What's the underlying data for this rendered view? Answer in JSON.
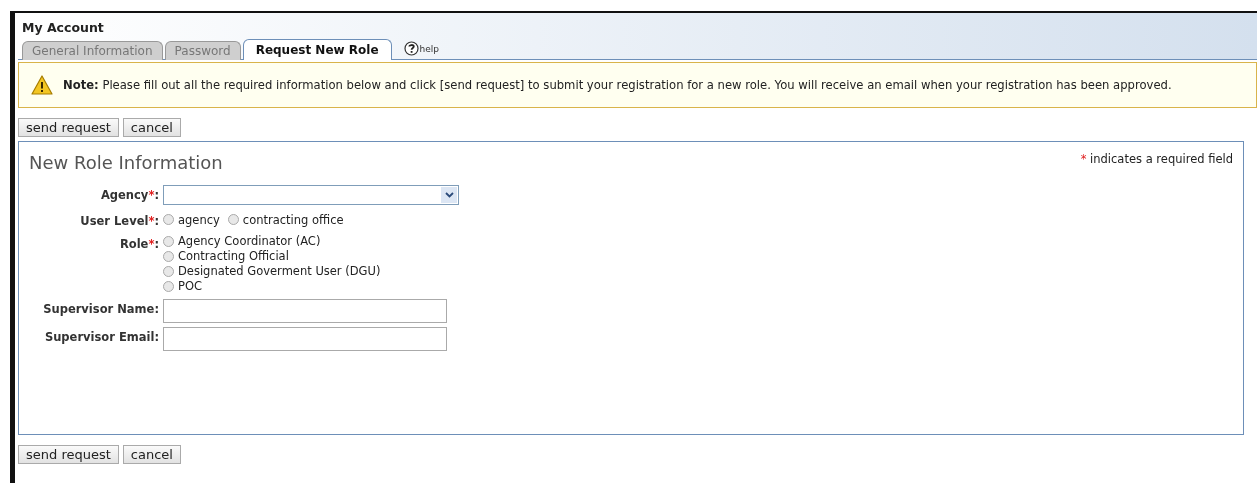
{
  "window": {
    "title": "My Account"
  },
  "tabs": [
    {
      "label": "General Information",
      "selected": false
    },
    {
      "label": "Password",
      "selected": false
    },
    {
      "label": "Request New Role",
      "selected": true
    }
  ],
  "help": {
    "label": "help"
  },
  "note": {
    "text": "**Note:** Please fill out all the required information below and click [send request] to submit your registration for a new role. You will receive an email when your registration has been approved."
  },
  "top_buttons": [
    "send request",
    "cancel"
  ],
  "panel": {
    "title": "New Role Information",
    "legend": {
      "mark": "*",
      "text": "indicates a required field"
    },
    "fields": [
      {
        "kind": "select",
        "label": "Agency",
        "required_mark": "*",
        "suffix": ":"
      },
      {
        "kind": "radio-inline",
        "label": "User Level",
        "required_mark": "*",
        "suffix": ":",
        "options": [
          {
            "label": "agency",
            "selected": false
          },
          {
            "label": "contracting office",
            "selected": false
          }
        ]
      },
      {
        "kind": "radio-list",
        "label": "Role",
        "required_mark": "*",
        "suffix": ":",
        "options": [
          {
            "label": "Agency Coordinator (AC)",
            "selected": false
          },
          {
            "label": "Contracting Official",
            "selected": false
          },
          {
            "label": "Designated Goverment User (DGU)",
            "selected": false
          },
          {
            "label": "POC",
            "selected": false
          }
        ]
      },
      {
        "kind": "text",
        "label": "Supervisor Name",
        "suffix": ":"
      },
      {
        "kind": "text",
        "label": "Supervisor Email",
        "suffix": ":"
      }
    ]
  },
  "bottom_buttons": [
    "send request",
    "cancel"
  ]
}
